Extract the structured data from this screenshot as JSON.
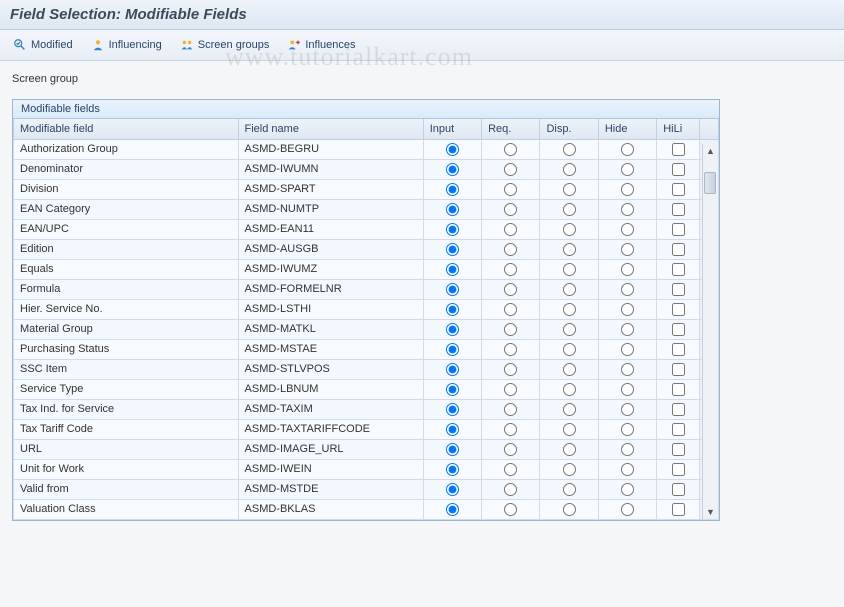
{
  "header": {
    "title": "Field Selection: Modifiable Fields"
  },
  "toolbar": {
    "modified": "Modified",
    "influencing": "Influencing",
    "screen_groups": "Screen groups",
    "influences": "Influences"
  },
  "content": {
    "screen_group_label": "Screen group"
  },
  "table": {
    "caption": "Modifiable fields",
    "columns": {
      "modifiable_field": "Modifiable field",
      "field_name": "Field name",
      "input": "Input",
      "req": "Req.",
      "disp": "Disp.",
      "hide": "Hide",
      "hili": "HiLi"
    },
    "rows": [
      {
        "label": "Authorization Group",
        "name": "ASMD-BEGRU",
        "sel": "input",
        "hili": false
      },
      {
        "label": "Denominator",
        "name": "ASMD-IWUMN",
        "sel": "input",
        "hili": false
      },
      {
        "label": "Division",
        "name": "ASMD-SPART",
        "sel": "input",
        "hili": false
      },
      {
        "label": "EAN Category",
        "name": "ASMD-NUMTP",
        "sel": "input",
        "hili": false
      },
      {
        "label": "EAN/UPC",
        "name": "ASMD-EAN11",
        "sel": "input",
        "hili": false
      },
      {
        "label": "Edition",
        "name": "ASMD-AUSGB",
        "sel": "input",
        "hili": false
      },
      {
        "label": "Equals",
        "name": "ASMD-IWUMZ",
        "sel": "input",
        "hili": false
      },
      {
        "label": "Formula",
        "name": "ASMD-FORMELNR",
        "sel": "input",
        "hili": false
      },
      {
        "label": "Hier. Service No.",
        "name": "ASMD-LSTHI",
        "sel": "input",
        "hili": false
      },
      {
        "label": "Material Group",
        "name": "ASMD-MATKL",
        "sel": "input",
        "hili": false
      },
      {
        "label": "Purchasing Status",
        "name": "ASMD-MSTAE",
        "sel": "input",
        "hili": false
      },
      {
        "label": "SSC Item",
        "name": "ASMD-STLVPOS",
        "sel": "input",
        "hili": false
      },
      {
        "label": "Service Type",
        "name": "ASMD-LBNUM",
        "sel": "input",
        "hili": false
      },
      {
        "label": "Tax Ind. for Service",
        "name": "ASMD-TAXIM",
        "sel": "input",
        "hili": false
      },
      {
        "label": "Tax Tariff Code",
        "name": "ASMD-TAXTARIFFCODE",
        "sel": "input",
        "hili": false
      },
      {
        "label": "URL",
        "name": "ASMD-IMAGE_URL",
        "sel": "input",
        "hili": false
      },
      {
        "label": "Unit for Work",
        "name": "ASMD-IWEIN",
        "sel": "input",
        "hili": false
      },
      {
        "label": "Valid from",
        "name": "ASMD-MSTDE",
        "sel": "input",
        "hili": false
      },
      {
        "label": "Valuation Class",
        "name": "ASMD-BKLAS",
        "sel": "input",
        "hili": false
      }
    ]
  },
  "watermark": "www.tutorialkart.com"
}
